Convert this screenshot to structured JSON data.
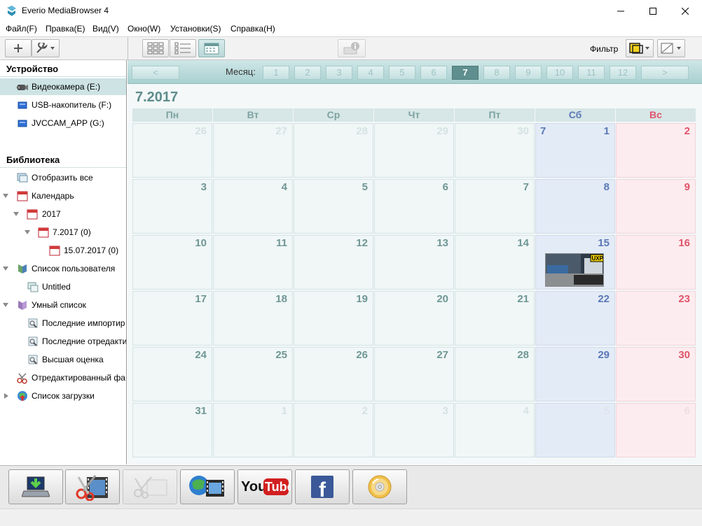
{
  "window": {
    "title": "Everio MediaBrowser 4"
  },
  "menu": [
    "Файл(F)",
    "Правка(E)",
    "Вид(V)",
    "Окно(W)",
    "Установки(S)",
    "Справка(H)"
  ],
  "toolbar": {
    "filter_label": "Фильтр"
  },
  "sidebar": {
    "device_header": "Устройство",
    "devices": [
      "Видеокамера (E:)",
      "USB-накопитель (F:)",
      "JVCCAM_APP (G:)"
    ],
    "library_header": "Библиотека",
    "library": [
      "Отобразить все",
      "Календарь",
      "2017",
      "7.2017 (0)",
      "15.07.2017 (0)",
      "Список пользователя",
      "Untitled",
      "Умный список",
      "Последние импортир",
      "Последние отредакти",
      "Высшая оценка",
      "Отредактированный фа",
      "Список загрузки"
    ]
  },
  "calendar": {
    "month_label": "Месяц:",
    "prev": "<",
    "next": ">",
    "months": [
      "1",
      "2",
      "3",
      "4",
      "5",
      "6",
      "7",
      "8",
      "9",
      "10",
      "11",
      "12"
    ],
    "active_month": "7",
    "title": "7.2017",
    "weekdays": [
      "Пн",
      "Вт",
      "Ср",
      "Чт",
      "Пт",
      "Сб",
      "Вс"
    ],
    "week_marker": "7",
    "days": [
      "26",
      "27",
      "28",
      "29",
      "30",
      "1",
      "2",
      "3",
      "4",
      "5",
      "6",
      "7",
      "8",
      "9",
      "10",
      "11",
      "12",
      "13",
      "14",
      "15",
      "16",
      "17",
      "18",
      "19",
      "20",
      "21",
      "22",
      "23",
      "24",
      "25",
      "26",
      "27",
      "28",
      "29",
      "30",
      "31",
      "1",
      "2",
      "3",
      "4",
      "5",
      "6"
    ],
    "thumbnail_badge": "UXP"
  },
  "bottom_buttons": [
    "import-icon",
    "edit-video-icon",
    "cut-icon",
    "upload-web-icon",
    "youtube-icon",
    "facebook-icon",
    "disc-icon"
  ],
  "youtube_text": {
    "you": "You",
    "tube": "Tube"
  },
  "facebook_text": "f"
}
